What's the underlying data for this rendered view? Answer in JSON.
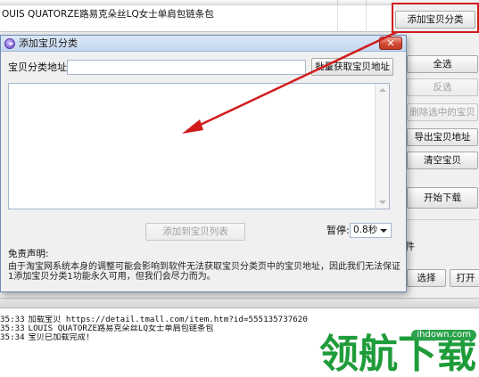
{
  "background_window": {
    "list_row": "OUIS QUATORZE路易克朵丝LQ女士单肩包链条包",
    "right_buttons": [
      {
        "label": "添加宝贝分类",
        "disabled": false
      },
      {
        "label": "全选",
        "disabled": false
      },
      {
        "label": "反选",
        "disabled": true
      },
      {
        "label": "删除选中的宝贝",
        "disabled": true
      },
      {
        "label": "导出宝贝地址",
        "disabled": false
      },
      {
        "label": "清空宝贝",
        "disabled": false
      },
      {
        "label": "开始下载",
        "disabled": false
      }
    ],
    "side_text": "件",
    "bottom_buttons": {
      "select": "选择",
      "open": "打开"
    }
  },
  "log": [
    {
      "time": "35:33",
      "text": "加载宝贝 https://detail.tmall.com/item.htm?id=555135737620"
    },
    {
      "time": "35:33",
      "text": "LOUIS QUATORZE路易克朵丝LQ女士单肩包链条包"
    },
    {
      "time": "35:34",
      "text": "宝贝已加载完成!"
    }
  ],
  "watermark": {
    "tag": "ihdown.com",
    "text": "领航下载"
  },
  "dialog": {
    "title": "添加宝贝分类",
    "close_label": "✕",
    "url_label": "宝贝分类地址:",
    "url_value": "",
    "batch_button": "批量获取宝贝地址",
    "add_button": "添加到宝贝列表",
    "pause_label": "暂停:",
    "pause_value": "0.8秒",
    "disclaimer_title": "免责声明:",
    "disclaimer_text": "由于淘宝网系统本身的调整可能会影响到软件无法获取宝贝分类页中的宝贝地址，因此我们无法保证1添加宝贝分类1功能永久可用，但我们会尽力而为。"
  },
  "colors": {
    "annotation_red": "#d11c1c",
    "watermark_green": "#1f9c3a"
  }
}
